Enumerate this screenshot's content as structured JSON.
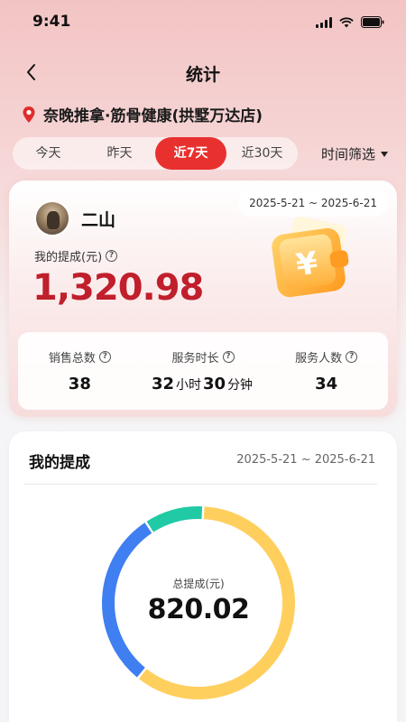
{
  "status": {
    "time": "9:41"
  },
  "nav": {
    "title": "统计"
  },
  "store": {
    "name": "奈晚推拿·筋骨健康(拱墅万达店)"
  },
  "filters": {
    "tabs": [
      "今天",
      "昨天",
      "近7天",
      "近30天"
    ],
    "active_index": 2,
    "time_filter_label": "时间筛选"
  },
  "summary": {
    "date_range": "2025-5-21 ~ 2025-6-21",
    "user_name": "二山",
    "earn_label": "我的提成(元)",
    "earn_amount": "1,320.98",
    "stats": [
      {
        "label": "销售总数",
        "value": "38"
      },
      {
        "label": "服务时长",
        "hours": "32",
        "hours_unit": "小时",
        "minutes": "30",
        "minutes_unit": "分钟"
      },
      {
        "label": "服务人数",
        "value": "34"
      }
    ]
  },
  "commission": {
    "title": "我的提成",
    "date_range": "2025-5-21 ~ 2025-6-21",
    "center_label": "总提成(元)",
    "center_value": "820.02"
  },
  "chart_data": {
    "type": "pie",
    "title": "",
    "center_label": "总提成(元)",
    "total": 820.02,
    "series": [
      {
        "value": 0.6,
        "color": "#ffcf5e"
      },
      {
        "value": 0.3,
        "color": "#3f7ff1"
      },
      {
        "value": 0.1,
        "color": "#1fcaa5"
      }
    ]
  },
  "colors": {
    "accent": "#e8312f",
    "amount": "#c01f2b"
  }
}
